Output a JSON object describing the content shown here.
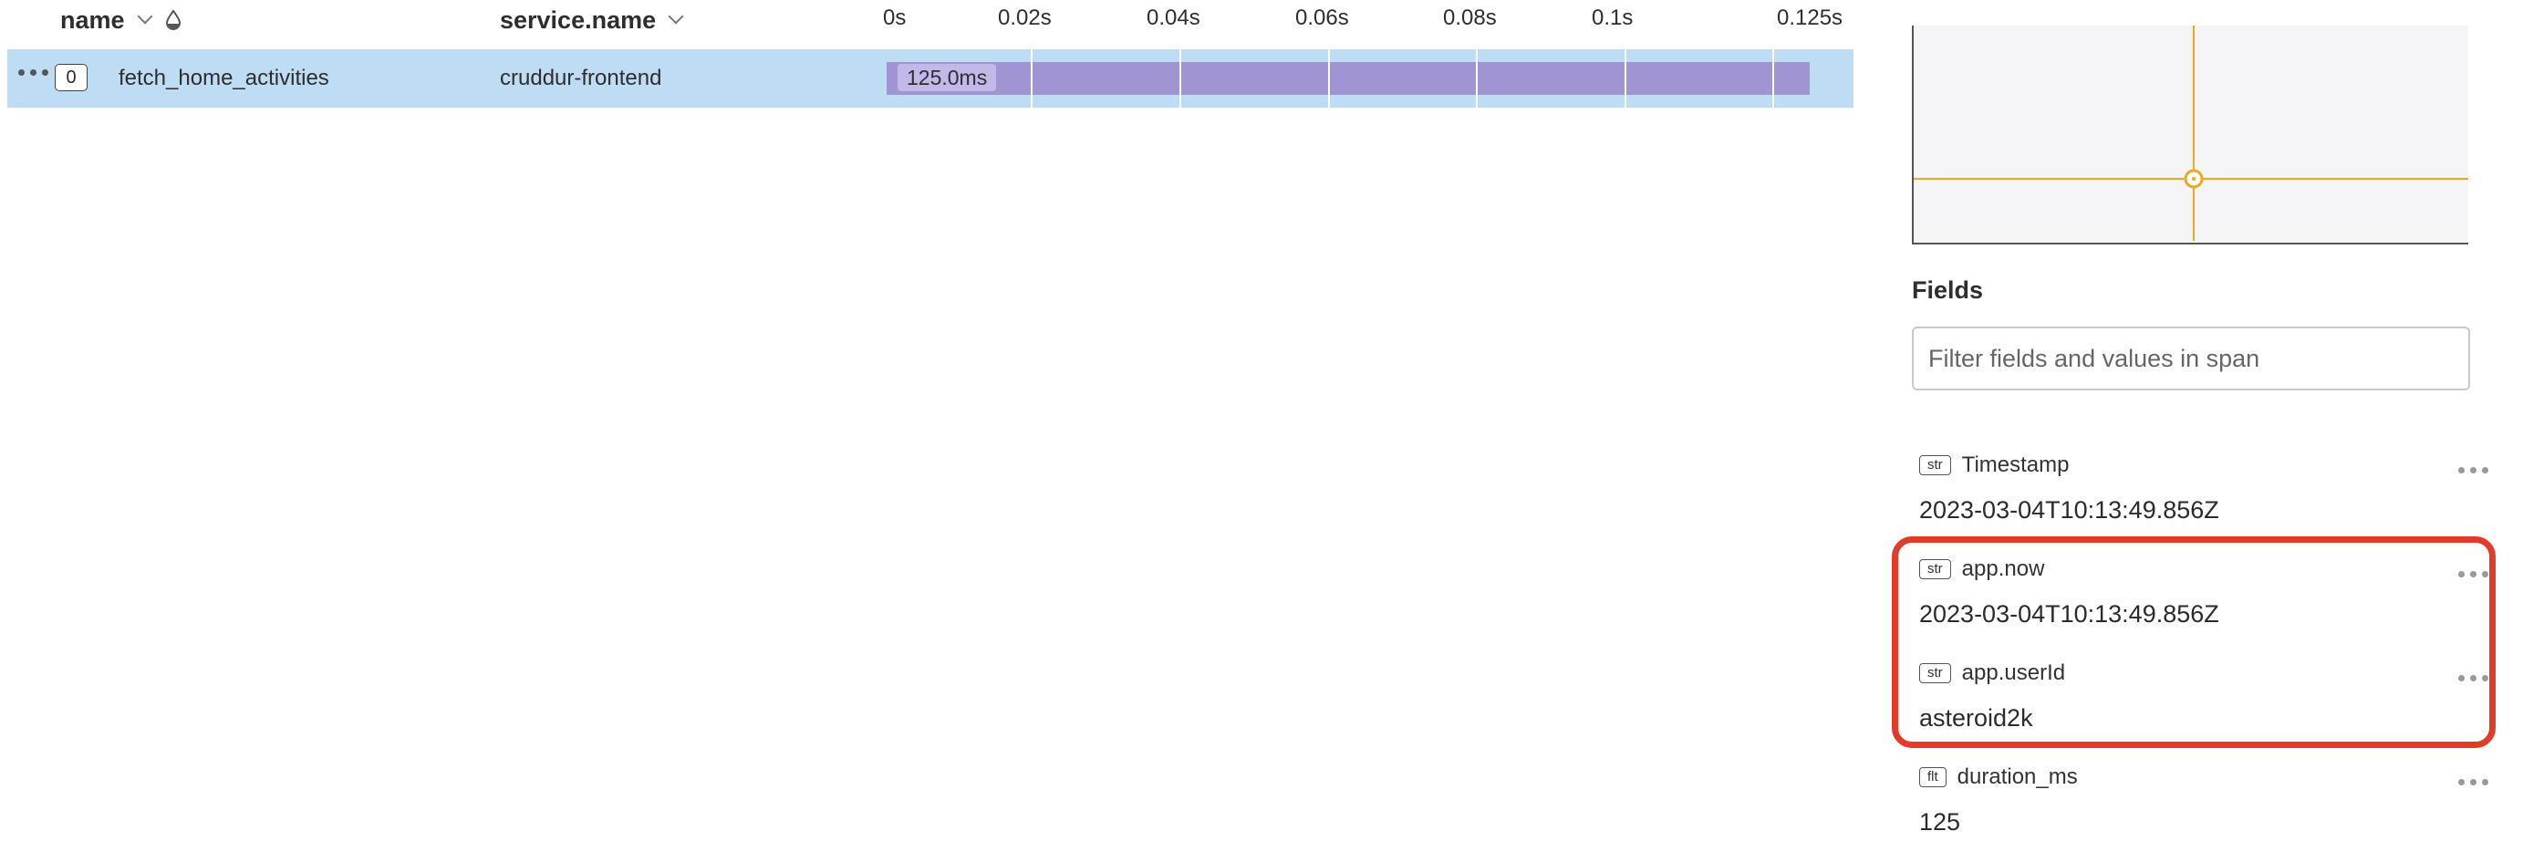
{
  "table": {
    "columns": {
      "name": "name",
      "service": "service.name"
    },
    "ticks": [
      "0s",
      "0.02s",
      "0.04s",
      "0.06s",
      "0.08s",
      "0.1s",
      "0.125s"
    ],
    "rows": [
      {
        "index": "0",
        "name": "fetch_home_activities",
        "service": "cruddur-frontend",
        "duration_label": "125.0ms"
      }
    ]
  },
  "panel": {
    "fields_title": "Fields",
    "filter_placeholder": "Filter fields and values in span",
    "fields": [
      {
        "type": "str",
        "name": "Timestamp",
        "value": "2023-03-04T10:13:49.856Z"
      },
      {
        "type": "str",
        "name": "app.now",
        "value": "2023-03-04T10:13:49.856Z"
      },
      {
        "type": "str",
        "name": "app.userId",
        "value": "asteroid2k"
      },
      {
        "type": "flt",
        "name": "duration_ms",
        "value": "125"
      }
    ]
  },
  "colors": {
    "row_selected": "#bfdcf5",
    "span_bar": "#a094d2",
    "crosshair": "#f0a81e",
    "highlight": "#e23b2a"
  }
}
